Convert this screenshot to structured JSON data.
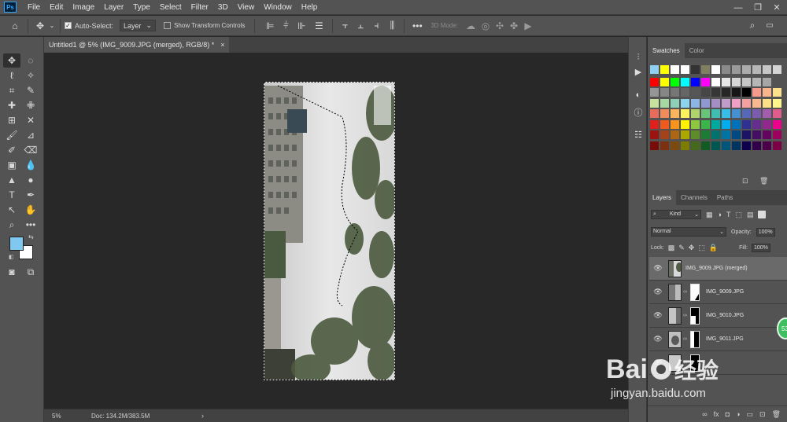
{
  "app": {
    "logo": "Ps"
  },
  "menu": [
    "File",
    "Edit",
    "Image",
    "Layer",
    "Type",
    "Select",
    "Filter",
    "3D",
    "View",
    "Window",
    "Help"
  ],
  "window_controls": [
    "—",
    "❐",
    "✕"
  ],
  "options_bar": {
    "auto_select_label": "Auto-Select:",
    "auto_select_checked": true,
    "auto_select_target": "Layer",
    "show_transform_label": "Show Transform Controls",
    "mode_3d_label": "3D Mode:",
    "more_label": "•••"
  },
  "document_tab": {
    "title": "Untitled1 @ 5% (IMG_9009.JPG (merged), RGB/8) *",
    "close": "×"
  },
  "status_bar": {
    "zoom": "5%",
    "doc_size": "Doc: 134.2M/383.5M",
    "arrow": "›"
  },
  "colors": {
    "foreground": "#7fc8f0",
    "background": "#ffffff"
  },
  "swatches_panel": {
    "tabs": [
      "Swatches",
      "Color"
    ],
    "rows": [
      [
        "#8ecff2",
        "#ffff00",
        "#ffffff",
        "#ffffff",
        "#333333",
        "#808060",
        "#ffffff",
        "#8a8a8a",
        "#9a9a9a",
        "#acacac",
        "#b6b6b6",
        "#c6c6c6",
        "#d4d4d4"
      ],
      [
        "#ff0000",
        "#ffff00",
        "#00ff00",
        "#00ffff",
        "#0000ff",
        "#ff00ff",
        "#ffffff",
        "#e6e6e6",
        "#d6d6d6",
        "#c6c6c6",
        "#b6b6b6",
        "#a6a6a6"
      ],
      [
        "#969696",
        "#868686",
        "#767676",
        "#666666",
        "#565656",
        "#464646",
        "#363636",
        "#262626",
        "#161616",
        "#000000",
        "#f59a8c",
        "#f8b48c",
        "#fde08c"
      ],
      [
        "#c6e29c",
        "#a8d8a2",
        "#8ed0b6",
        "#8cd4ee",
        "#8cb4e4",
        "#9098d0",
        "#a48ec4",
        "#c09cc8",
        "#f0a0c4",
        "#f4a0a0",
        "#f8b890",
        "#fce088",
        "#fff58c"
      ],
      [
        "#e86c5c",
        "#f08c5c",
        "#fbb45c",
        "#fff25c",
        "#b0d46c",
        "#68c478",
        "#40bcb0",
        "#38bce8",
        "#4490d0",
        "#5868b8",
        "#7c5cac",
        "#a45cac",
        "#e05c8c"
      ],
      [
        "#e0201c",
        "#ef5a1e",
        "#f7941d",
        "#fff200",
        "#8dc63f",
        "#39b54a",
        "#00a99d",
        "#00aeef",
        "#0072bc",
        "#2e3192",
        "#662d91",
        "#92278f",
        "#ec008c"
      ],
      [
        "#9c1410",
        "#a4421a",
        "#ac6614",
        "#aca800",
        "#5e8c28",
        "#1c7c34",
        "#00746c",
        "#0074a4",
        "#004a84",
        "#1b1464",
        "#440e62",
        "#630460",
        "#9e005d"
      ],
      [
        "#780c08",
        "#7c3010",
        "#7c4a0c",
        "#7c7c00",
        "#466a1c",
        "#125c24",
        "#005650",
        "#00567a",
        "#003460",
        "#0d004c",
        "#32004b",
        "#4b0049",
        "#7b0046"
      ]
    ]
  },
  "layers_panel": {
    "tabs": [
      "Layers",
      "Channels",
      "Paths"
    ],
    "filter_kind": "Kind",
    "blend_mode": "Normal",
    "opacity_label": "Opacity:",
    "opacity_value": "100%",
    "lock_label": "Lock:",
    "fill_label": "Fill:",
    "fill_value": "100%",
    "layers": [
      {
        "name": "IMG_9009.JPG (merged)",
        "selected": true,
        "has_mask": false
      },
      {
        "name": "IMG_9009.JPG",
        "selected": false,
        "has_mask": true
      },
      {
        "name": "IMG_9010.JPG",
        "selected": false,
        "has_mask": true
      },
      {
        "name": "IMG_9011.JPG",
        "selected": false,
        "has_mask": true
      },
      {
        "name": "",
        "selected": false,
        "has_mask": true
      }
    ],
    "bottom_icons": [
      "link-icon",
      "fx-icon",
      "add-mask-icon",
      "adjustment-icon",
      "folder-icon",
      "new-layer-icon",
      "trash-icon"
    ]
  },
  "badge": {
    "text": "53"
  },
  "watermark": {
    "brand": "Bai",
    "brand_cn": "经验",
    "url": "jingyan.baidu.com"
  }
}
